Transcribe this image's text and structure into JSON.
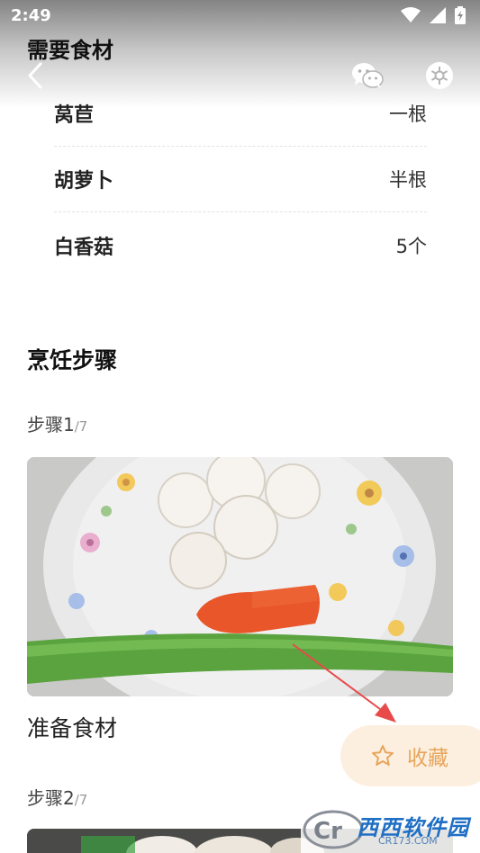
{
  "status_bar": {
    "time": "2:49"
  },
  "nav": {
    "section_title_peek": "需要食材"
  },
  "ingredients": [
    {
      "name": "莴苣",
      "amount": "一根"
    },
    {
      "name": "胡萝卜",
      "amount": "半根"
    },
    {
      "name": "白香菇",
      "amount": "5个"
    }
  ],
  "steps_title": "烹饪步骤",
  "steps": [
    {
      "label": "步骤1",
      "total": "/7",
      "description": "准备食材"
    },
    {
      "label": "步骤2",
      "total": "/7"
    }
  ],
  "favorite_button": {
    "label": "收藏"
  },
  "watermark": {
    "text": "西西软件园",
    "sub": "CR173.COM",
    "letter": "Cr"
  },
  "colors": {
    "accent": "#e7a55b",
    "favorite_bg": "#fdefe0",
    "annotation_arrow": "#e84a4a"
  }
}
